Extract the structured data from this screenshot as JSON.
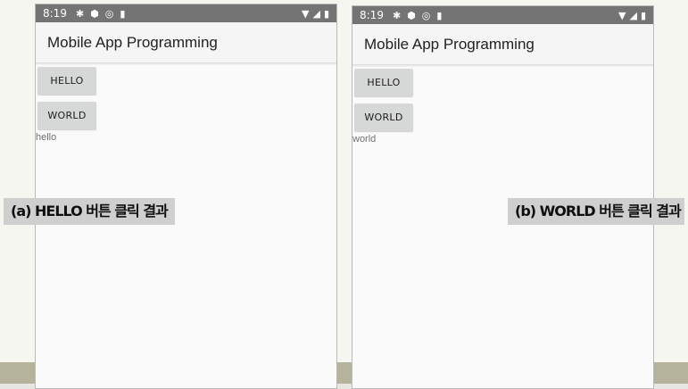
{
  "panels": [
    {
      "status": {
        "time": "8:19"
      },
      "app_title": "Mobile App Programming",
      "buttons": {
        "hello": "HELLO",
        "world": "WORLD"
      },
      "result_text": "hello",
      "caption": "(a) HELLO 버튼 클릭 결과"
    },
    {
      "status": {
        "time": "8:19"
      },
      "app_title": "Mobile App Programming",
      "buttons": {
        "hello": "HELLO",
        "world": "WORLD"
      },
      "result_text": "world",
      "caption": "(b) WORLD 버튼 클릭 결과"
    }
  ],
  "icons": [
    "settings-icon",
    "shield-icon",
    "sync-icon",
    "sd-card-icon",
    "wifi-icon",
    "cell-signal-icon",
    "battery-icon"
  ],
  "colors": {
    "status_bar": "#747474",
    "button": "#d6d7d7",
    "app_bar": "#f5f5f5",
    "caption_bg": "#cfcfcf"
  }
}
